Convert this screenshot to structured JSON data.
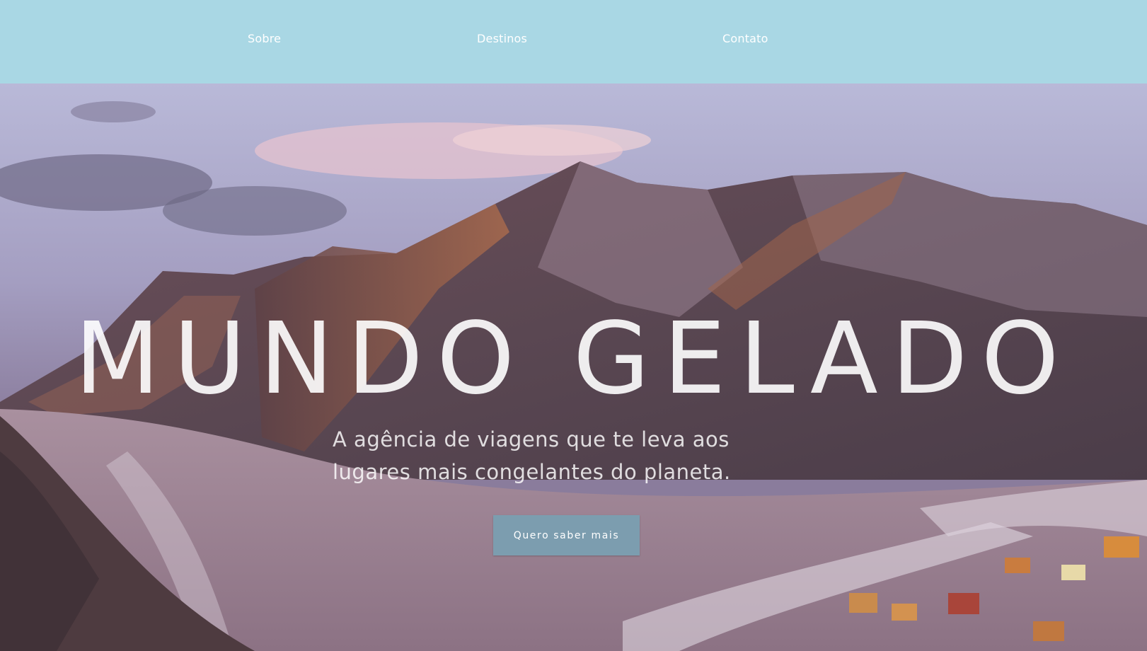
{
  "nav": {
    "items": [
      {
        "label": "Sobre"
      },
      {
        "label": "Destinos"
      },
      {
        "label": "Contato"
      }
    ],
    "background": "#a9d7e4"
  },
  "hero": {
    "title": "MUNDO GELADO",
    "subtitle": "A agência de viagens que te leva aos lugares mais congelantes do planeta.",
    "cta_label": "Quero saber mais",
    "cta_color": "#7c9daf",
    "image": "snowy-mountain-frozen-lake-photo"
  }
}
